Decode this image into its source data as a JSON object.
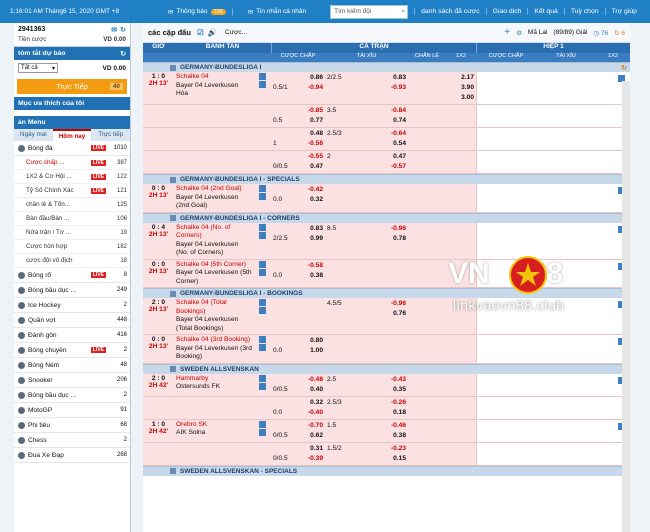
{
  "topbar": {
    "clock": "1:16:01 AM Tháng6 15, 2020 GMT +8",
    "notice": "Thông báo",
    "notice_count": "235",
    "messages": "Tin nhắn cá nhân",
    "search_placeholder": "Tìm kiếm đội",
    "nav": [
      "danh sách đã cược",
      "Giao dịch",
      "Kết quả",
      "Tuỳ chọn",
      "Trợ giúp"
    ]
  },
  "sidebar": {
    "account": "2941363",
    "credit_label": "Tiền cược",
    "credit_value": "VD 0.00",
    "summary_title": "tóm tắt dự báo",
    "filter_value": "Tất cả",
    "filter_amount": "VD 0.00",
    "live_label": "Trực Tiếp",
    "live_count": "40",
    "fav_title": "Mục ưa thích của tôi",
    "menu_title": "ản Menu",
    "tabs": [
      "Ngày mai",
      "Hôm nay",
      "Trực tiếp"
    ],
    "live_badge": "LIVE",
    "sports": [
      {
        "name": "Bóng đá",
        "live": true,
        "count": "1010",
        "subs": [
          {
            "name": "Cược chấp ...",
            "live": true,
            "count": "387",
            "selected": true
          },
          {
            "name": "1X2 & Cơ Hội ...",
            "live": true,
            "count": "122"
          },
          {
            "name": "Tỷ Số Chính Xác",
            "live": true,
            "count": "121"
          },
          {
            "name": "chẵn lẻ & Tổn...",
            "live": false,
            "count": "125"
          },
          {
            "name": "Bàn đầu/Bàn ...",
            "live": false,
            "count": "106"
          },
          {
            "name": "Nửa trận / Tơ ...",
            "live": false,
            "count": "19"
          },
          {
            "name": "Cược hỗn hợp",
            "live": false,
            "count": "182"
          },
          {
            "name": "cược đội vô địch",
            "live": false,
            "count": "18"
          }
        ]
      },
      {
        "name": "Bóng rổ",
        "live": true,
        "count": "8"
      },
      {
        "name": "Bóng bầu dục ...",
        "live": false,
        "count": "249"
      },
      {
        "name": "Ice Hockey",
        "live": false,
        "count": "2"
      },
      {
        "name": "Quần vợt",
        "live": false,
        "count": "448"
      },
      {
        "name": "Đánh gôn",
        "live": false,
        "count": "416"
      },
      {
        "name": "Bóng chuyền",
        "live": true,
        "count": "2"
      },
      {
        "name": "Bóng Ném",
        "live": false,
        "count": "48"
      },
      {
        "name": "Snooker",
        "live": false,
        "count": "206"
      },
      {
        "name": "Bóng bầu dục ...",
        "live": false,
        "count": "2"
      },
      {
        "name": "MotoGP",
        "live": false,
        "count": "91"
      },
      {
        "name": "Phi tiêu",
        "live": false,
        "count": "68"
      },
      {
        "name": "Chess",
        "live": false,
        "count": "2"
      },
      {
        "name": "Đua Xe Đạp",
        "live": false,
        "count": "268"
      }
    ]
  },
  "main": {
    "title": "các cặp đấu",
    "bet_select": "Cược...",
    "odds_type": "Mã Lai",
    "count_text": "(89/89) Giải",
    "c1": "76",
    "c2": "6",
    "head": {
      "time": "GIỜ",
      "team": "BANH TAN",
      "full": "CẢ TRẬN",
      "half": "HIỆP 1",
      "hdp": "CƯỢC CHẤP",
      "ou": "TÀI XỈU",
      "oe": "CHẴN LẺ",
      "x12": "1X2",
      "hhdp": "CƯỢC CHẤP",
      "hou": "TÀI XỈU",
      "hx12": "1X2"
    },
    "leagues": [
      {
        "name": "GERMANY-BUNDESLIGA I",
        "rows": [
          {
            "score": "1 : 0",
            "time": "2H 13'",
            "home": "Schalke 04",
            "away": "Bayer 04 Leverkusen",
            "draw": "Hòa",
            "hdp": "0.5/1",
            "hv": [
              "0.86",
              "-0.94"
            ],
            "ou": "2/2.5",
            "ov": [
              "0.83",
              "-0.93"
            ],
            "x12": [
              "2.17",
              "3.90",
              "3.00"
            ]
          },
          {
            "hdp": "0.5",
            "hv": [
              "-0.85",
              "0.77"
            ],
            "ou": "3.5",
            "ov": [
              "-0.84",
              "0.74"
            ]
          },
          {
            "hdp": "1",
            "hv": [
              "0.48",
              "-0.56"
            ],
            "ou": "2.5/3",
            "ov": [
              "-0.64",
              "0.54"
            ]
          },
          {
            "hdp": "0/0.5",
            "hv": [
              "-0.55",
              "0.47"
            ],
            "ou": "2",
            "ov": [
              "0.47",
              "-0.57"
            ]
          }
        ]
      },
      {
        "name": "GERMANY-BUNDESLIGA I - SPECIALS",
        "rows": [
          {
            "score": "0 : 0",
            "time": "2H 13'",
            "home": "Schalke 04 (2nd Goal)",
            "away": "Bayer 04 Leverkusen (2nd Goal)",
            "hdp": "0.0",
            "hv": [
              "-0.42",
              "0.32"
            ]
          }
        ]
      },
      {
        "name": "GERMANY-BUNDESLIGA I - CORNERS",
        "rows": [
          {
            "score": "0 : 4",
            "time": "2H 13'",
            "home": "Schalke 04 (No. of Corners)",
            "away": "Bayer 04 Leverkusen (No. of Corners)",
            "hdp": "2/2.5",
            "hv": [
              "0.83",
              "0.99"
            ],
            "ou": "8.5",
            "ov": [
              "-0.96",
              "0.78"
            ]
          },
          {
            "score": "0 : 0",
            "time": "2H 13'",
            "home": "Schalke 04 (5th Corner)",
            "away": "Bayer 04 Leverkusen (5th Corner)",
            "hdp": "0.0",
            "hv": [
              "-0.58",
              "0.38"
            ]
          }
        ]
      },
      {
        "name": "GERMANY-BUNDESLIGA I - BOOKINGS",
        "rows": [
          {
            "score": "2 : 0",
            "time": "2H 13'",
            "home": "Schalke 04 (Total Bookings)",
            "away": "Bayer 04 Leverkusen (Total Bookings)",
            "ou": "4.5/5",
            "ov": [
              "-0.96",
              "0.76"
            ]
          },
          {
            "score": "0 : 0",
            "time": "2H 13'",
            "home": "Schalke 04 (3rd Booking)",
            "away": "Bayer 04 Leverkusen (3rd Booking)",
            "hdp": "0.0",
            "hv": [
              "0.80",
              "1.00"
            ]
          }
        ]
      },
      {
        "name": "SWEDEN ALLSVENSKAN",
        "rows": [
          {
            "score": "2 : 0",
            "time": "2H 42'",
            "home": "Hammarby",
            "away": "Ostersunds FK",
            "hdp": "0/0.5",
            "hv": [
              "-0.48",
              "0.40"
            ],
            "ou": "2.5",
            "ov": [
              "-0.43",
              "0.35"
            ]
          },
          {
            "hdp": "0.0",
            "hv": [
              "0.32",
              "-0.40"
            ],
            "ou": "2.5/3",
            "ov": [
              "-0.26",
              "0.18"
            ]
          },
          {
            "score": "1 : 0",
            "time": "2H 42'",
            "home": "Orebro SK",
            "away": "AIK Solna",
            "hdp": "0/0.5",
            "hv": [
              "-0.70",
              "0.62"
            ],
            "ou": "1.5",
            "ov": [
              "-0.46",
              "0.38"
            ]
          },
          {
            "hdp": "0/0.5",
            "hv": [
              "0.31",
              "-0.39"
            ],
            "ou": "1.5/2",
            "ov": [
              "-0.23",
              "0.15"
            ]
          }
        ]
      }
    ],
    "next_league": "SWEDEN ALLSVENSKAN - SPECIALS"
  },
  "watermark": {
    "brand_left": "VN",
    "brand_right": "88",
    "url": "linkvaovn88.club"
  },
  "colors": {
    "top_blue": "#1f80c6",
    "live_red": "#dd2222",
    "row_pink": "#fbe1e1",
    "league_blue": "#c7d8ea"
  }
}
